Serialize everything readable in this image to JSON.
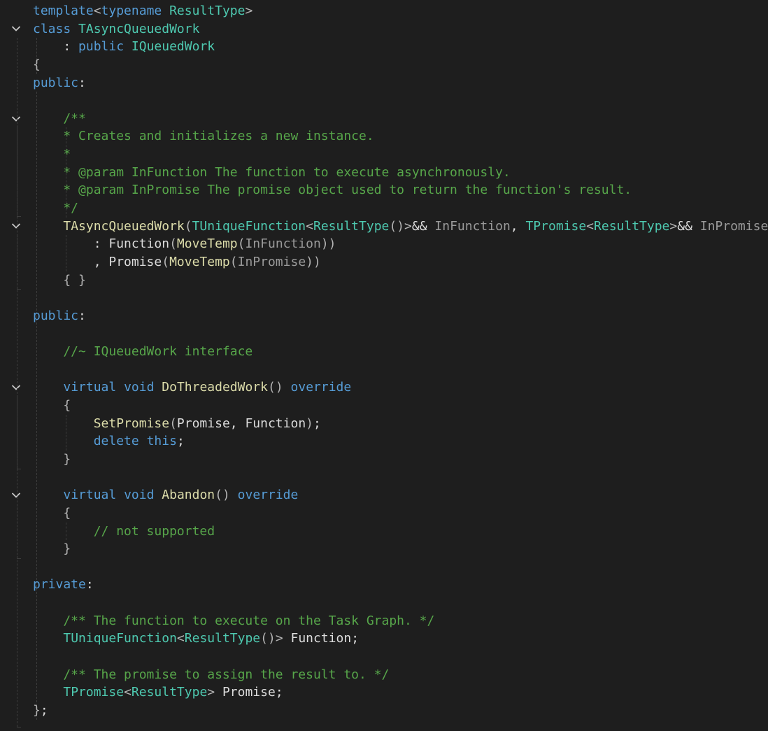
{
  "lines": [
    {
      "tokens": [
        {
          "c": "kw",
          "t": "template"
        },
        {
          "c": "punc",
          "t": "<"
        },
        {
          "c": "kw",
          "t": "typename"
        },
        {
          "c": "tx",
          "t": " "
        },
        {
          "c": "type",
          "t": "ResultType"
        },
        {
          "c": "punc",
          "t": ">"
        }
      ]
    },
    {
      "tokens": [
        {
          "c": "kw",
          "t": "class"
        },
        {
          "c": "tx",
          "t": " "
        },
        {
          "c": "type",
          "t": "TAsyncQueuedWork"
        }
      ]
    },
    {
      "tokens": [
        {
          "c": "tx",
          "t": "    : "
        },
        {
          "c": "kw",
          "t": "public"
        },
        {
          "c": "tx",
          "t": " "
        },
        {
          "c": "type",
          "t": "IQueuedWork"
        }
      ]
    },
    {
      "tokens": [
        {
          "c": "punc",
          "t": "{"
        }
      ]
    },
    {
      "tokens": [
        {
          "c": "kw",
          "t": "public"
        },
        {
          "c": "tx",
          "t": ":"
        }
      ]
    },
    {
      "tokens": []
    },
    {
      "tokens": [
        {
          "c": "cm",
          "t": "    /**"
        }
      ]
    },
    {
      "tokens": [
        {
          "c": "cm",
          "t": "    * Creates and initializes a new instance."
        }
      ]
    },
    {
      "tokens": [
        {
          "c": "cm",
          "t": "    *"
        }
      ]
    },
    {
      "tokens": [
        {
          "c": "cm",
          "t": "    * @param InFunction The function to execute asynchronously."
        }
      ]
    },
    {
      "tokens": [
        {
          "c": "cm",
          "t": "    * @param InPromise The promise object used to return the function's result."
        }
      ]
    },
    {
      "tokens": [
        {
          "c": "cm",
          "t": "    */"
        }
      ]
    },
    {
      "tokens": [
        {
          "c": "tx",
          "t": "    "
        },
        {
          "c": "fn",
          "t": "TAsyncQueuedWork"
        },
        {
          "c": "punc",
          "t": "("
        },
        {
          "c": "type",
          "t": "TUniqueFunction"
        },
        {
          "c": "punc",
          "t": "<"
        },
        {
          "c": "type",
          "t": "ResultType"
        },
        {
          "c": "punc",
          "t": "()>"
        },
        {
          "c": "tx",
          "t": "&& "
        },
        {
          "c": "prm",
          "t": "InFunction"
        },
        {
          "c": "tx",
          "t": ", "
        },
        {
          "c": "type",
          "t": "TPromise"
        },
        {
          "c": "punc",
          "t": "<"
        },
        {
          "c": "type",
          "t": "ResultType"
        },
        {
          "c": "punc",
          "t": ">"
        },
        {
          "c": "tx",
          "t": "&& "
        },
        {
          "c": "prm",
          "t": "InPromise"
        },
        {
          "c": "punc",
          "t": ")"
        }
      ]
    },
    {
      "tokens": [
        {
          "c": "tx",
          "t": "        : Function"
        },
        {
          "c": "punc",
          "t": "("
        },
        {
          "c": "fn",
          "t": "MoveTemp"
        },
        {
          "c": "punc",
          "t": "("
        },
        {
          "c": "prm",
          "t": "InFunction"
        },
        {
          "c": "punc",
          "t": "))"
        }
      ]
    },
    {
      "tokens": [
        {
          "c": "tx",
          "t": "        , Promise"
        },
        {
          "c": "punc",
          "t": "("
        },
        {
          "c": "fn",
          "t": "MoveTemp"
        },
        {
          "c": "punc",
          "t": "("
        },
        {
          "c": "prm",
          "t": "InPromise"
        },
        {
          "c": "punc",
          "t": "))"
        }
      ]
    },
    {
      "tokens": [
        {
          "c": "tx",
          "t": "    "
        },
        {
          "c": "punc",
          "t": "{ }"
        }
      ]
    },
    {
      "tokens": []
    },
    {
      "tokens": [
        {
          "c": "kw",
          "t": "public"
        },
        {
          "c": "tx",
          "t": ":"
        }
      ]
    },
    {
      "tokens": []
    },
    {
      "tokens": [
        {
          "c": "cm",
          "t": "    //~ IQueuedWork interface"
        }
      ]
    },
    {
      "tokens": []
    },
    {
      "tokens": [
        {
          "c": "tx",
          "t": "    "
        },
        {
          "c": "kw",
          "t": "virtual"
        },
        {
          "c": "tx",
          "t": " "
        },
        {
          "c": "kw",
          "t": "void"
        },
        {
          "c": "tx",
          "t": " "
        },
        {
          "c": "fn",
          "t": "DoThreadedWork"
        },
        {
          "c": "punc",
          "t": "()"
        },
        {
          "c": "tx",
          "t": " "
        },
        {
          "c": "kw",
          "t": "override"
        }
      ]
    },
    {
      "tokens": [
        {
          "c": "tx",
          "t": "    "
        },
        {
          "c": "punc",
          "t": "{"
        }
      ]
    },
    {
      "tokens": [
        {
          "c": "tx",
          "t": "        "
        },
        {
          "c": "fn",
          "t": "SetPromise"
        },
        {
          "c": "punc",
          "t": "("
        },
        {
          "c": "tx",
          "t": "Promise, Function"
        },
        {
          "c": "punc",
          "t": ")"
        },
        {
          "c": "tx",
          "t": ";"
        }
      ]
    },
    {
      "tokens": [
        {
          "c": "tx",
          "t": "        "
        },
        {
          "c": "kw",
          "t": "delete"
        },
        {
          "c": "tx",
          "t": " "
        },
        {
          "c": "kw",
          "t": "this"
        },
        {
          "c": "tx",
          "t": ";"
        }
      ]
    },
    {
      "tokens": [
        {
          "c": "tx",
          "t": "    "
        },
        {
          "c": "punc",
          "t": "}"
        }
      ]
    },
    {
      "tokens": []
    },
    {
      "tokens": [
        {
          "c": "tx",
          "t": "    "
        },
        {
          "c": "kw",
          "t": "virtual"
        },
        {
          "c": "tx",
          "t": " "
        },
        {
          "c": "kw",
          "t": "void"
        },
        {
          "c": "tx",
          "t": " "
        },
        {
          "c": "fn",
          "t": "Abandon"
        },
        {
          "c": "punc",
          "t": "()"
        },
        {
          "c": "tx",
          "t": " "
        },
        {
          "c": "kw",
          "t": "override"
        }
      ]
    },
    {
      "tokens": [
        {
          "c": "tx",
          "t": "    "
        },
        {
          "c": "punc",
          "t": "{"
        }
      ]
    },
    {
      "tokens": [
        {
          "c": "cm",
          "t": "        // not supported"
        }
      ]
    },
    {
      "tokens": [
        {
          "c": "tx",
          "t": "    "
        },
        {
          "c": "punc",
          "t": "}"
        }
      ]
    },
    {
      "tokens": []
    },
    {
      "tokens": [
        {
          "c": "kw",
          "t": "private"
        },
        {
          "c": "tx",
          "t": ":"
        }
      ]
    },
    {
      "tokens": []
    },
    {
      "tokens": [
        {
          "c": "cm",
          "t": "    /** The function to execute on the Task Graph. */"
        }
      ]
    },
    {
      "tokens": [
        {
          "c": "tx",
          "t": "    "
        },
        {
          "c": "type",
          "t": "TUniqueFunction"
        },
        {
          "c": "punc",
          "t": "<"
        },
        {
          "c": "type",
          "t": "ResultType"
        },
        {
          "c": "punc",
          "t": "()>"
        },
        {
          "c": "tx",
          "t": " Function;"
        }
      ]
    },
    {
      "tokens": []
    },
    {
      "tokens": [
        {
          "c": "cm",
          "t": "    /** The promise to assign the result to. */"
        }
      ]
    },
    {
      "tokens": [
        {
          "c": "tx",
          "t": "    "
        },
        {
          "c": "type",
          "t": "TPromise"
        },
        {
          "c": "punc",
          "t": "<"
        },
        {
          "c": "type",
          "t": "ResultType"
        },
        {
          "c": "punc",
          "t": ">"
        },
        {
          "c": "tx",
          "t": " Promise;"
        }
      ]
    },
    {
      "tokens": [
        {
          "c": "punc",
          "t": "}"
        },
        {
          "c": "tx",
          "t": ";"
        }
      ]
    }
  ],
  "folds": [
    1,
    6,
    12,
    21,
    27
  ],
  "fold_icon": "chevron-down-icon",
  "colors": {
    "background": "#1e1e1e",
    "keyword": "#569cd6",
    "type": "#4ec9b0",
    "function": "#dcdcaa",
    "comment": "#57a64a",
    "text": "#dcdcdc",
    "parameter": "#9a9a9a"
  }
}
